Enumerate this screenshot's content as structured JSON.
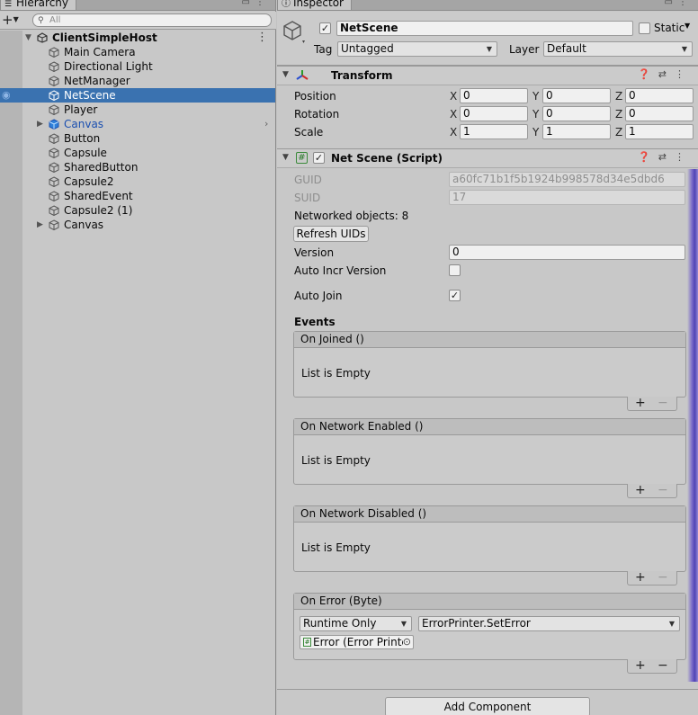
{
  "hierarchy": {
    "tab_label": "Hierarchy",
    "search_placeholder": "All",
    "root": "ClientSimpleHost",
    "items": [
      {
        "label": "Main Camera"
      },
      {
        "label": "Directional Light"
      },
      {
        "label": "NetManager"
      },
      {
        "label": "NetScene",
        "selected": true
      },
      {
        "label": "Player"
      },
      {
        "label": "Canvas",
        "prefab": true,
        "expandable": true
      },
      {
        "label": "Button"
      },
      {
        "label": "Capsule"
      },
      {
        "label": "SharedButton"
      },
      {
        "label": "Capsule2"
      },
      {
        "label": "SharedEvent"
      },
      {
        "label": "Capsule2 (1)"
      },
      {
        "label": "Canvas",
        "expandable": true
      }
    ]
  },
  "inspector": {
    "tab_label": "Inspector",
    "object_name": "NetScene",
    "static_label": "Static",
    "tag_label": "Tag",
    "tag_value": "Untagged",
    "layer_label": "Layer",
    "layer_value": "Default",
    "transform": {
      "title": "Transform",
      "position_label": "Position",
      "rotation_label": "Rotation",
      "scale_label": "Scale",
      "position": {
        "x": "0",
        "y": "0",
        "z": "0"
      },
      "rotation": {
        "x": "0",
        "y": "0",
        "z": "0"
      },
      "scale": {
        "x": "1",
        "y": "1",
        "z": "1"
      }
    },
    "script": {
      "title": "Net Scene (Script)",
      "guid_label": "GUID",
      "guid_value": "a60fc71b1f5b1924b998578d34e5dbd6",
      "suid_label": "SUID",
      "suid_value": "17",
      "networked_objects": "Networked objects: 8",
      "refresh_button": "Refresh UIDs",
      "version_label": "Version",
      "version_value": "0",
      "auto_incr_label": "Auto Incr Version",
      "auto_join_label": "Auto Join",
      "events_label": "Events",
      "events": [
        {
          "title": "On Joined ()",
          "empty": "List is Empty"
        },
        {
          "title": "On Network Enabled ()",
          "empty": "List is Empty"
        },
        {
          "title": "On Network Disabled ()",
          "empty": "List is Empty"
        }
      ],
      "on_error": {
        "title": "On Error (Byte)",
        "mode": "Runtime Only",
        "function": "ErrorPrinter.SetError",
        "target": "Error (Error Printe"
      }
    },
    "add_component": "Add Component",
    "xyz": {
      "x": "X",
      "y": "Y",
      "z": "Z"
    },
    "plus": "+",
    "minus": "−"
  },
  "colors": {
    "selection": "#3a72b0",
    "prefab_text": "#1a4fb0",
    "panel": "#c8c8c8"
  }
}
